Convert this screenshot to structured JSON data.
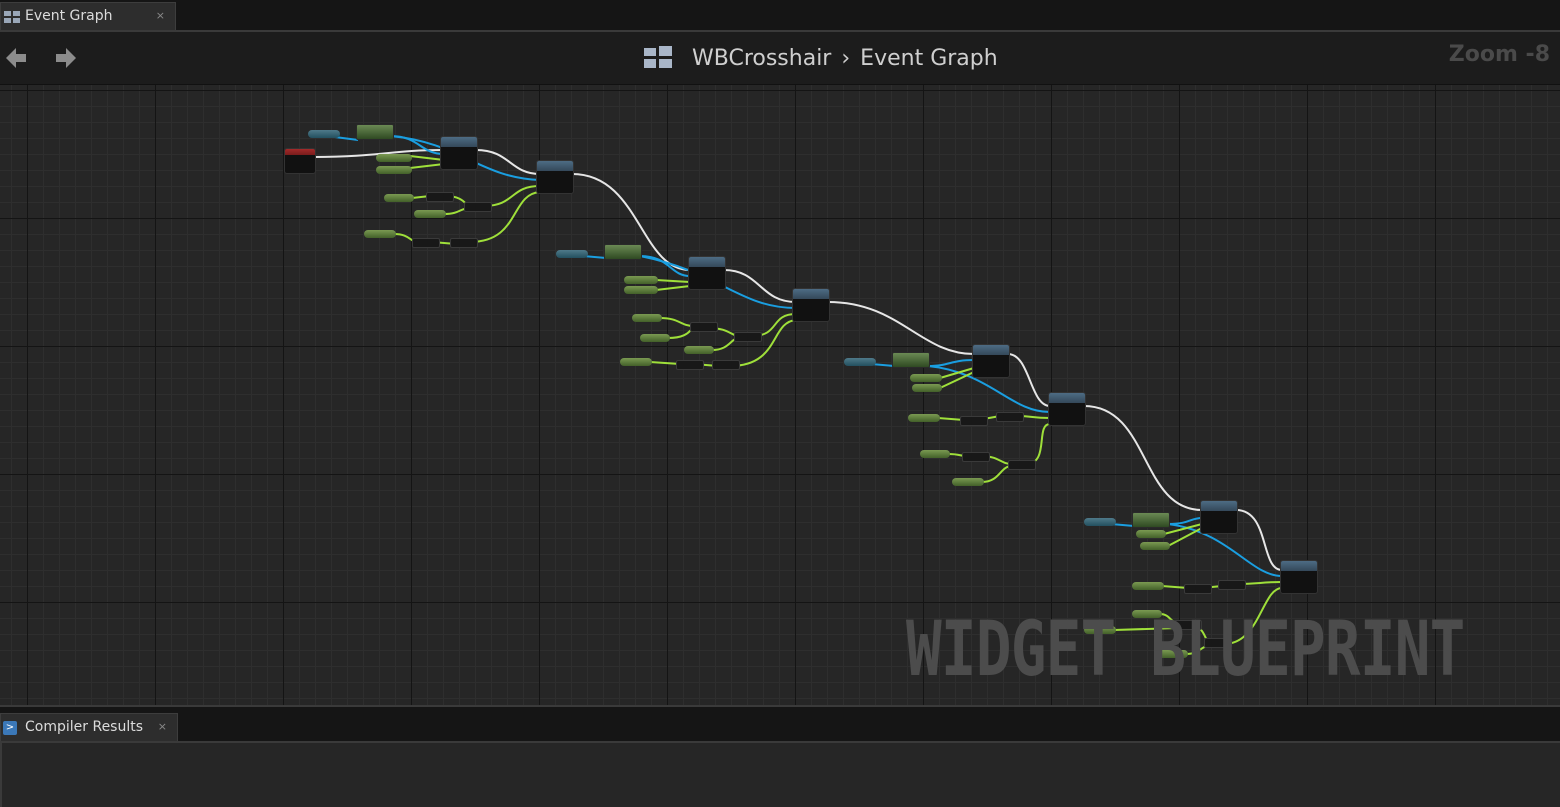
{
  "tabs": {
    "graph_tab": {
      "label": "Event Graph",
      "close": "×"
    },
    "compiler_tab": {
      "label": "Compiler Results",
      "close": "×"
    }
  },
  "graph_header": {
    "crumb_blueprint": "WBCrosshair",
    "crumb_separator": "›",
    "crumb_graph": "Event Graph",
    "zoom": "Zoom -8"
  },
  "watermark": "WIDGET BLUEPRINT",
  "colors": {
    "exec_wire": "#e8e8e8",
    "object_wire": "#1a9ee0",
    "float_wire": "#9fe03a",
    "event_node": "#a32a2a",
    "function_node_header": "#4d6c84"
  }
}
